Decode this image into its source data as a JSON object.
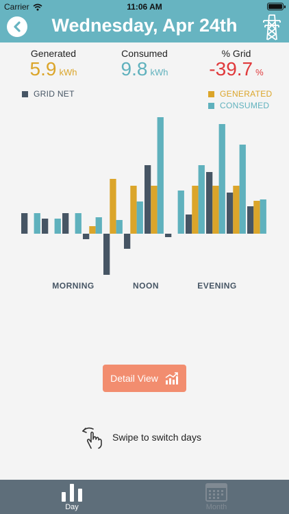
{
  "status_bar": {
    "carrier": "Carrier",
    "time": "11:06 AM"
  },
  "header": {
    "title": "Wednesday, Apr 24th"
  },
  "stats": {
    "generated": {
      "label": "Generated",
      "value": "5.9",
      "unit": "kWh"
    },
    "consumed": {
      "label": "Consumed",
      "value": "9.8",
      "unit": "kWh"
    },
    "grid": {
      "label": "% Grid",
      "value": "-39.7",
      "unit": "%"
    }
  },
  "colors": {
    "generated": "#dba52a",
    "consumed": "#5fb1bd",
    "grid_net": "#465564",
    "accent": "#67b4c1",
    "negative": "#e0393b",
    "button": "#f28d6f"
  },
  "chart_data": {
    "type": "bar",
    "series": [
      {
        "name": "GRID NET",
        "values": [
          3,
          2.2,
          3,
          -0.8,
          -6,
          -2.2,
          10,
          -0.5,
          2.8,
          9,
          6,
          4
        ]
      },
      {
        "name": "GENERATED",
        "values": [
          0,
          0,
          0,
          1.1,
          8,
          7,
          7,
          0,
          7,
          7,
          7,
          4.8
        ]
      },
      {
        "name": "CONSUMED",
        "values": [
          3,
          2.2,
          3,
          2.4,
          2,
          4.7,
          17,
          6.3,
          10,
          16,
          13,
          5
        ]
      }
    ],
    "x_labels": [
      "MORNING",
      "NOON",
      "EVENING"
    ],
    "legend_position": "top",
    "grid": false
  },
  "actions": {
    "detail_label": "Detail View",
    "swipe_hint": "Swipe to switch days"
  },
  "tabs": {
    "day": "Day",
    "month": "Month"
  }
}
